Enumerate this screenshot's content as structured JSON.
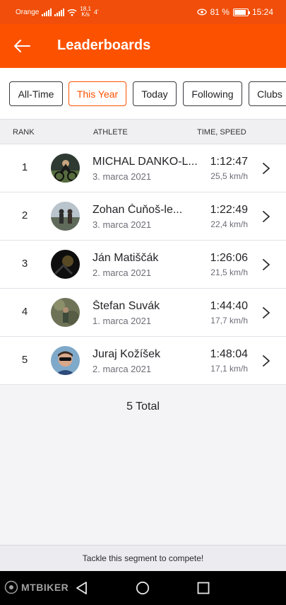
{
  "status_bar": {
    "carrier": "Orange",
    "network_speed_value": "18,1",
    "network_speed_unit": "K/s",
    "extra": "4'",
    "battery": "81 %",
    "time": "15:24"
  },
  "header": {
    "title": "Leaderboards"
  },
  "filters": [
    {
      "label": "All-Time",
      "active": false
    },
    {
      "label": "This Year",
      "active": true
    },
    {
      "label": "Today",
      "active": false
    },
    {
      "label": "Following",
      "active": false
    },
    {
      "label": "Clubs",
      "active": false
    }
  ],
  "table": {
    "columns": {
      "rank": "RANK",
      "athlete": "ATHLETE",
      "time_speed": "TIME, SPEED"
    },
    "rows": [
      {
        "rank": "1",
        "name": "MICHAL DANKO-L...",
        "date": "3. marca 2021",
        "time": "1:12:47",
        "speed": "25,5 km/h"
      },
      {
        "rank": "2",
        "name": "Zohan Čuňoš-le...",
        "date": "3. marca 2021",
        "time": "1:22:49",
        "speed": "22,4 km/h"
      },
      {
        "rank": "3",
        "name": "Ján Matiščák",
        "date": "2. marca 2021",
        "time": "1:26:06",
        "speed": "21,5 km/h"
      },
      {
        "rank": "4",
        "name": "Štefan Suvák",
        "date": "1. marca 2021",
        "time": "1:44:40",
        "speed": "17,7 km/h"
      },
      {
        "rank": "5",
        "name": "Juraj Kožíšek",
        "date": "2. marca 2021",
        "time": "1:48:04",
        "speed": "17,1 km/h"
      }
    ]
  },
  "total": "5 Total",
  "footer": {
    "cta": "Tackle this segment to compete!"
  },
  "watermark": "MTBIKER",
  "colors": {
    "brand": "#fc5200",
    "status_bar": "#f04e0a"
  }
}
